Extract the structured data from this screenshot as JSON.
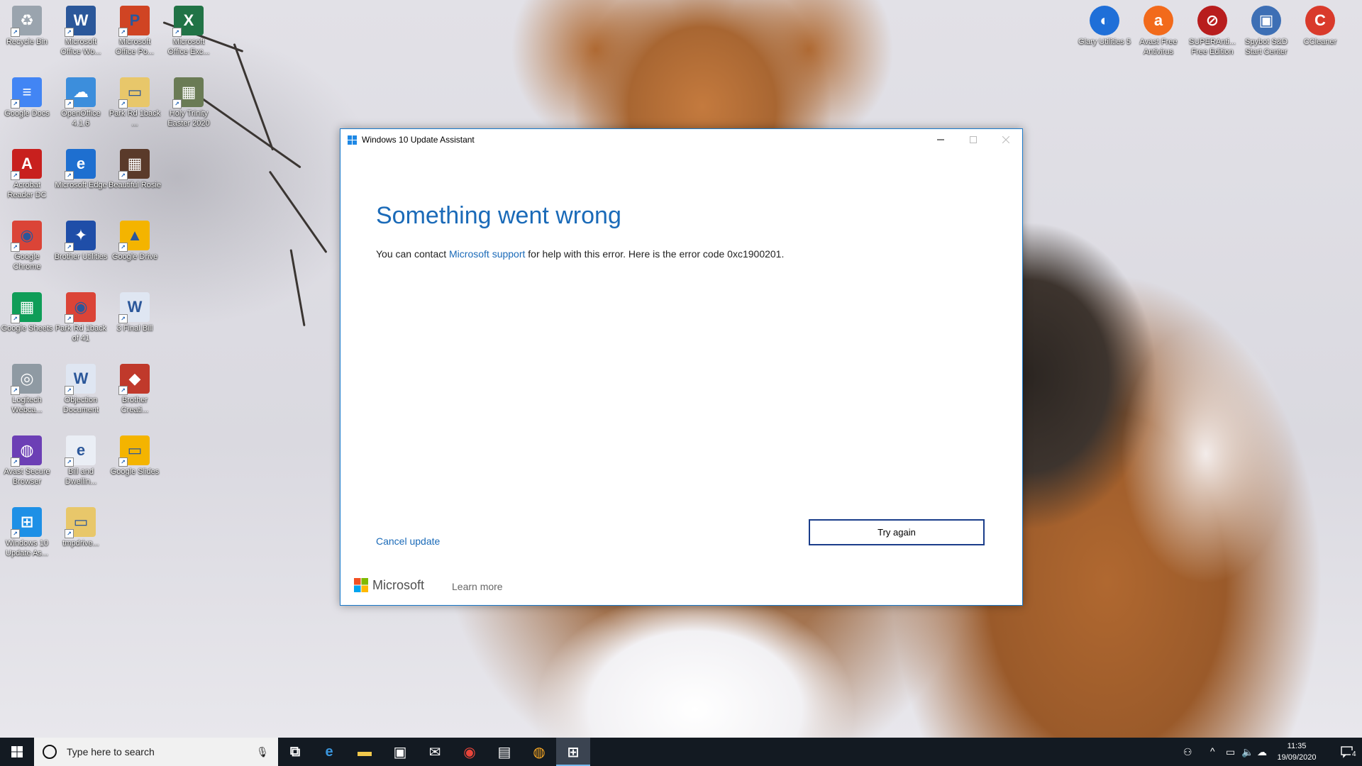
{
  "desktop_icons_left": [
    {
      "label": "Recycle Bin",
      "icon": "recycle-bin-icon",
      "color": "#9aa4ae",
      "glyph": "♻"
    },
    {
      "label": "Microsoft Office Wo...",
      "icon": "word-icon",
      "color": "#2b579a",
      "glyph": "W"
    },
    {
      "label": "Microsoft Office Po...",
      "icon": "powerpoint-icon",
      "color": "#d04423",
      "glyph": "P"
    },
    {
      "label": "Microsoft Office Exc...",
      "icon": "excel-icon",
      "color": "#217346",
      "glyph": "X"
    },
    {
      "label": "Google Docs",
      "icon": "google-docs-icon",
      "color": "#4285f4",
      "glyph": "≡"
    },
    {
      "label": "OpenOffice 4.1.6",
      "icon": "openoffice-icon",
      "color": "#3c8edc",
      "glyph": "☁"
    },
    {
      "label": "Park Rd 1back ...",
      "icon": "folder-icon",
      "color": "#e8c76a",
      "glyph": "▭"
    },
    {
      "label": "Holy Trinity Easter 2020",
      "icon": "photo-icon",
      "color": "#6a7b55",
      "glyph": "▦"
    },
    {
      "label": "Acrobat Reader DC",
      "icon": "acrobat-icon",
      "color": "#c8201e",
      "glyph": "A"
    },
    {
      "label": "Microsoft Edge",
      "icon": "edge-icon",
      "color": "#1e6fd0",
      "glyph": "e"
    },
    {
      "label": "Beautiful Rosie",
      "icon": "photo-icon",
      "color": "#5a3a2a",
      "glyph": "▦"
    },
    {
      "label": "Google Chrome",
      "icon": "chrome-icon",
      "color": "#db4437",
      "glyph": "◉"
    },
    {
      "label": "Brother Utilities",
      "icon": "brother-utilities-icon",
      "color": "#1f4ea8",
      "glyph": "✦"
    },
    {
      "label": "Google Drive",
      "icon": "google-drive-icon",
      "color": "#f4b400",
      "glyph": "▲"
    },
    {
      "label": "Google Sheets",
      "icon": "google-sheets-icon",
      "color": "#0f9d58",
      "glyph": "▦"
    },
    {
      "label": "Park Rd 1back of 41",
      "icon": "chrome-icon",
      "color": "#db4437",
      "glyph": "◉"
    },
    {
      "label": "3 Final Bill",
      "icon": "word-document-icon",
      "color": "#dfe6f2",
      "glyph": "W"
    },
    {
      "label": "Logitech Webca...",
      "icon": "webcam-icon",
      "color": "#8f9aa3",
      "glyph": "◎"
    },
    {
      "label": "Objection Document",
      "icon": "word-document-icon",
      "color": "#dfe6f2",
      "glyph": "W"
    },
    {
      "label": "Brother Creati...",
      "icon": "brother-creative-icon",
      "color": "#c0392b",
      "glyph": "◆"
    },
    {
      "label": "Avast Secure Browser",
      "icon": "avast-browser-icon",
      "color": "#6c3fb5",
      "glyph": "◍"
    },
    {
      "label": "Bill and Dwellin...",
      "icon": "pdf-document-icon",
      "color": "#eaeef5",
      "glyph": "e"
    },
    {
      "label": "Google Slides",
      "icon": "google-slides-icon",
      "color": "#f4b400",
      "glyph": "▭"
    },
    {
      "label": "Windows 10 Update As...",
      "icon": "windows-update-icon",
      "color": "#1e90e6",
      "glyph": "⊞"
    },
    {
      "label": "tmpdrive...",
      "icon": "folder-icon",
      "color": "#e8c76a",
      "glyph": "▭"
    }
  ],
  "desktop_icons_right": [
    {
      "label": "Glary Utilities 5",
      "icon": "glary-utilities-icon",
      "color": "#1f6fd8",
      "glyph": "◐"
    },
    {
      "label": "Avast Free Antivirus",
      "icon": "avast-icon",
      "color": "#f26a1b",
      "glyph": "a"
    },
    {
      "label": "SUPERAnti... Free Edition",
      "icon": "superantispyware-icon",
      "color": "#b81d1d",
      "glyph": "⊘"
    },
    {
      "label": "Spybot S&D Start Center",
      "icon": "spybot-icon",
      "color": "#3d6fb5",
      "glyph": "▣"
    },
    {
      "label": "CCleaner",
      "icon": "ccleaner-icon",
      "color": "#d93a2b",
      "glyph": "C"
    }
  ],
  "dialog": {
    "title": "Windows 10 Update Assistant",
    "heading": "Something went wrong",
    "message_before": "You can contact ",
    "message_link": "Microsoft support",
    "message_after": " for help with this error. Here is the error code 0xc1900201.",
    "cancel_label": "Cancel update",
    "try_again_label": "Try again",
    "brand": "Microsoft",
    "learn_more": "Learn more",
    "accent_color": "#1a6ab8"
  },
  "taskbar": {
    "search_placeholder": "Type here to search",
    "apps": [
      {
        "name": "task-view-icon",
        "glyph": "⧉"
      },
      {
        "name": "edge-icon",
        "glyph": "e"
      },
      {
        "name": "file-explorer-icon",
        "glyph": "▬"
      },
      {
        "name": "store-icon",
        "glyph": "▣"
      },
      {
        "name": "mail-icon",
        "glyph": "✉"
      },
      {
        "name": "chrome-icon",
        "glyph": "◉"
      },
      {
        "name": "control-panel-icon",
        "glyph": "▤"
      },
      {
        "name": "avast-browser-icon",
        "glyph": "◍"
      },
      {
        "name": "windows-update-assistant-icon",
        "glyph": "⊞"
      }
    ],
    "time": "11:35",
    "date": "19/09/2020",
    "notification_count": "4"
  }
}
